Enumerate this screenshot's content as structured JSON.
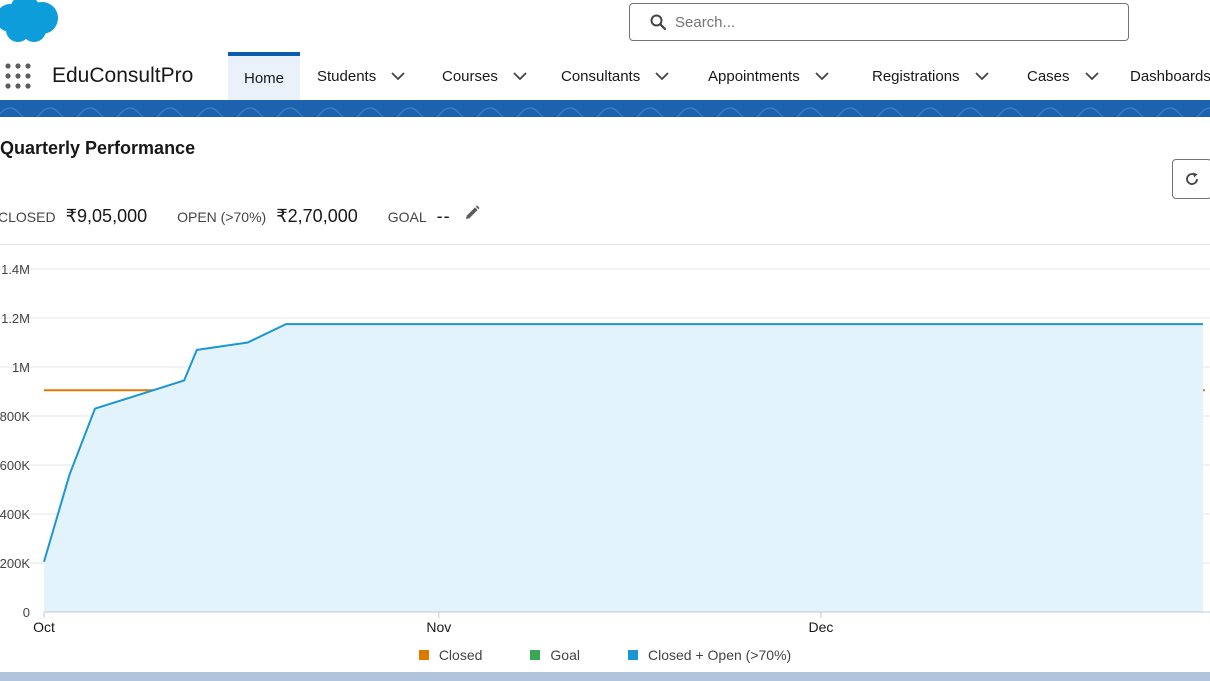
{
  "header": {
    "search": {
      "placeholder": "Search..."
    }
  },
  "nav": {
    "app_name": "EduConsultPro",
    "tabs": [
      {
        "label": "Home",
        "active": true,
        "dropdown": false
      },
      {
        "label": "Students",
        "active": false,
        "dropdown": true
      },
      {
        "label": "Courses",
        "active": false,
        "dropdown": true
      },
      {
        "label": "Consultants",
        "active": false,
        "dropdown": true
      },
      {
        "label": "Appointments",
        "active": false,
        "dropdown": true
      },
      {
        "label": "Registrations",
        "active": false,
        "dropdown": true
      },
      {
        "label": "Cases",
        "active": false,
        "dropdown": true
      },
      {
        "label": "Dashboards",
        "active": false,
        "dropdown": false
      }
    ]
  },
  "card": {
    "title": "Quarterly Performance",
    "metrics": {
      "closed_label": "CLOSED",
      "closed_value": "₹9,05,000",
      "open_label": "OPEN (>70%)",
      "open_value": "₹2,70,000",
      "goal_label": "GOAL",
      "goal_value": "--"
    }
  },
  "colors": {
    "brand_blue": "#1c62ae",
    "closed": "#dd7a01",
    "goal": "#3ba755",
    "closed_open": "#1b96d4",
    "closed_open_fill": "#e3f3fb"
  },
  "chart_data": {
    "type": "line",
    "x_type": "date",
    "xlim": [
      "2023-10-01",
      "2023-12-31"
    ],
    "x_ticks": [
      "Oct",
      "Nov",
      "Dec"
    ],
    "x_tick_dates": [
      "2023-10-01",
      "2023-11-01",
      "2023-12-01"
    ],
    "y_ticks": [
      "0",
      "200K",
      "400K",
      "600K",
      "800K",
      "1M",
      "1.2M",
      "1.4M"
    ],
    "y_tick_values": [
      0,
      200000,
      400000,
      600000,
      800000,
      1000000,
      1200000,
      1400000
    ],
    "ylim": [
      0,
      1400000
    ],
    "grid": true,
    "legend_position": "bottom",
    "series": [
      {
        "name": "Closed",
        "color": "#dd7a01",
        "x": [
          "2023-10-01",
          "2023-12-31"
        ],
        "y": [
          905000,
          905000
        ]
      },
      {
        "name": "Goal",
        "color": "#3ba755",
        "x": [],
        "y": []
      },
      {
        "name": "Closed + Open (>70%)",
        "color": "#1b96d4",
        "area": true,
        "x": [
          "2023-10-01",
          "2023-10-03",
          "2023-10-05",
          "2023-10-12",
          "2023-10-13",
          "2023-10-17",
          "2023-10-20",
          "2023-12-31"
        ],
        "y": [
          205000,
          560000,
          830000,
          945000,
          1070000,
          1100000,
          1175000,
          1175000
        ]
      }
    ]
  }
}
